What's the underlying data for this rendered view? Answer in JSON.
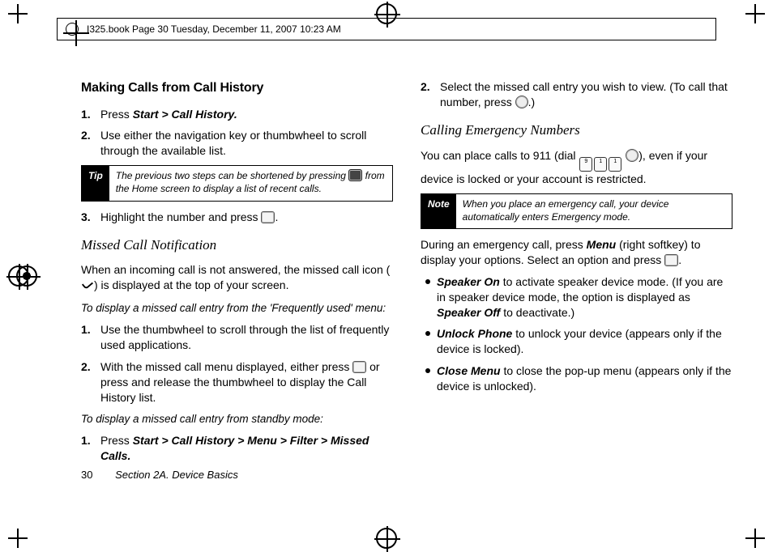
{
  "header": {
    "text": "I325.book  Page 30  Tuesday, December 11, 2007  10:23 AM"
  },
  "left": {
    "h1": "Making Calls from Call History",
    "step1_a": "Press ",
    "step1_b": "Start > Call History.",
    "step2": "Use either the navigation key or thumbwheel to scroll through the available list.",
    "tip_tag": "Tip",
    "tip_a": "The previous two steps can be shortened by pressing ",
    "tip_b": " from the Home screen to display a list of recent calls.",
    "step3_a": "Highlight the number and press ",
    "step3_b": ".",
    "h2": "Missed Call Notification",
    "p1_a": "When an incoming call is not answered, the missed call icon (",
    "p1_b": ") is displayed at the top of your screen.",
    "sub1": "To display a missed call entry from the 'Frequently used' menu:",
    "s1": "Use the thumbwheel to scroll through the list of frequently used applications.",
    "s2_a": "With the missed call menu displayed, either press ",
    "s2_b": " or press and release the thumbwheel to display the Call History list."
  },
  "right": {
    "sub1": "To display a missed call entry from standby mode:",
    "r1_a": "Press ",
    "r1_b": "Start > Call History > Menu > Filter > Missed Calls.",
    "r2_a": "Select the missed call entry you wish to view. (To call that number, press ",
    "r2_b": ".)",
    "h2": "Calling Emergency Numbers",
    "p1_a": "You can place calls to 911 (dial ",
    "p1_b": "), even if your device is locked or your account is restricted.",
    "note_tag": "Note",
    "note": "When you place an emergency call, your device automatically enters Emergency mode.",
    "p2_a": "During an emergency call, press ",
    "p2_b": "Menu",
    "p2_c": " (right softkey) to display your options. Select an option and press ",
    "p2_d": ".",
    "b1_t": "Speaker On",
    "b1_a": " to activate speaker device mode. (If you are in speaker device mode, the option is displayed as ",
    "b1_s": "Speaker Off",
    "b1_b": " to deactivate.)",
    "b2_t": "Unlock Phone",
    "b2": " to unlock your device (appears only if the device is locked).",
    "b3_t": "Close Menu",
    "b3": " to close the pop-up menu (appears only if the device is unlocked)."
  },
  "footer": {
    "page": "30",
    "section": "Section 2A. Device Basics"
  },
  "keys": {
    "k9": "9",
    "k1": "1",
    "k1b": "1"
  }
}
